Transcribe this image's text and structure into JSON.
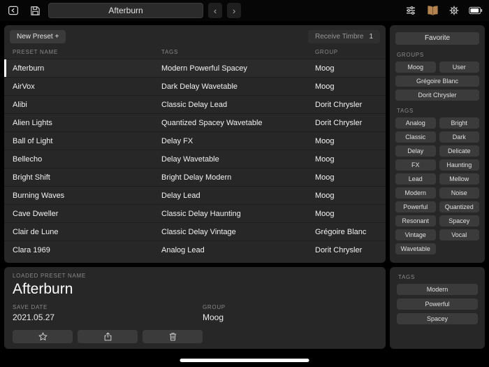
{
  "colors": {
    "panel": "#272727",
    "button": "#3b3b3b",
    "library_icon": "#b5834f",
    "selection_bar": "#ffffff"
  },
  "topbar": {
    "title": "Afterburn",
    "prev_label": "‹",
    "next_label": "›",
    "icons": [
      "back-icon",
      "save-icon",
      "prev-icon",
      "next-icon",
      "mixer-icon",
      "library-icon",
      "settings-icon",
      "battery-icon"
    ]
  },
  "preset_panel": {
    "new_preset_label": "New Preset +",
    "receive_timbre": {
      "label": "Receive Timbre",
      "count": "1"
    },
    "columns": [
      "PRESET NAME",
      "TAGS",
      "GROUP"
    ],
    "rows": [
      {
        "name": "Afterburn",
        "tags": "Modern Powerful Spacey",
        "group": "Moog",
        "selected": true
      },
      {
        "name": "AirVox",
        "tags": "Dark Delay Wavetable",
        "group": "Moog"
      },
      {
        "name": "Alibi",
        "tags": "Classic Delay Lead",
        "group": "Dorit Chrysler"
      },
      {
        "name": "Alien Lights",
        "tags": "Quantized Spacey Wavetable",
        "group": "Dorit Chrysler"
      },
      {
        "name": "Ball of Light",
        "tags": "Delay FX",
        "group": "Moog"
      },
      {
        "name": "Bellecho",
        "tags": "Delay Wavetable",
        "group": "Moog"
      },
      {
        "name": "Bright Shift",
        "tags": "Bright Delay Modern",
        "group": "Moog"
      },
      {
        "name": "Burning Waves",
        "tags": "Delay Lead",
        "group": "Moog"
      },
      {
        "name": "Cave Dweller",
        "tags": "Classic Delay Haunting",
        "group": "Moog"
      },
      {
        "name": "Clair de Lune",
        "tags": "Classic Delay Vintage",
        "group": "Grégoire Blanc"
      },
      {
        "name": "Clara 1969",
        "tags": "Analog Lead",
        "group": "Dorit Chrysler"
      }
    ]
  },
  "filter_panel": {
    "favorite_label": "Favorite",
    "groups_label": "GROUPS",
    "groups": [
      "Moog",
      "User",
      "Grégoire Blanc",
      "Dorit Chrysler"
    ],
    "tags_label": "TAGS",
    "tags": [
      "Analog",
      "Bright",
      "Classic",
      "Dark",
      "Delay",
      "Delicate",
      "FX",
      "Haunting",
      "Lead",
      "Mellow",
      "Modern",
      "Noise",
      "Powerful",
      "Quantized",
      "Resonant",
      "Spacey",
      "Vintage",
      "Vocal",
      "Wavetable"
    ]
  },
  "loaded_preset": {
    "name_label": "LOADED PRESET NAME",
    "name": "Afterburn",
    "save_date_label": "SAVE DATE",
    "save_date": "2021.05.27",
    "group_label": "GROUP",
    "group": "Moog",
    "action_icons": [
      "favorite-star-icon",
      "share-icon",
      "delete-icon"
    ]
  },
  "loaded_tags": {
    "label": "TAGS",
    "tags": [
      "Modern",
      "Powerful",
      "Spacey"
    ]
  }
}
